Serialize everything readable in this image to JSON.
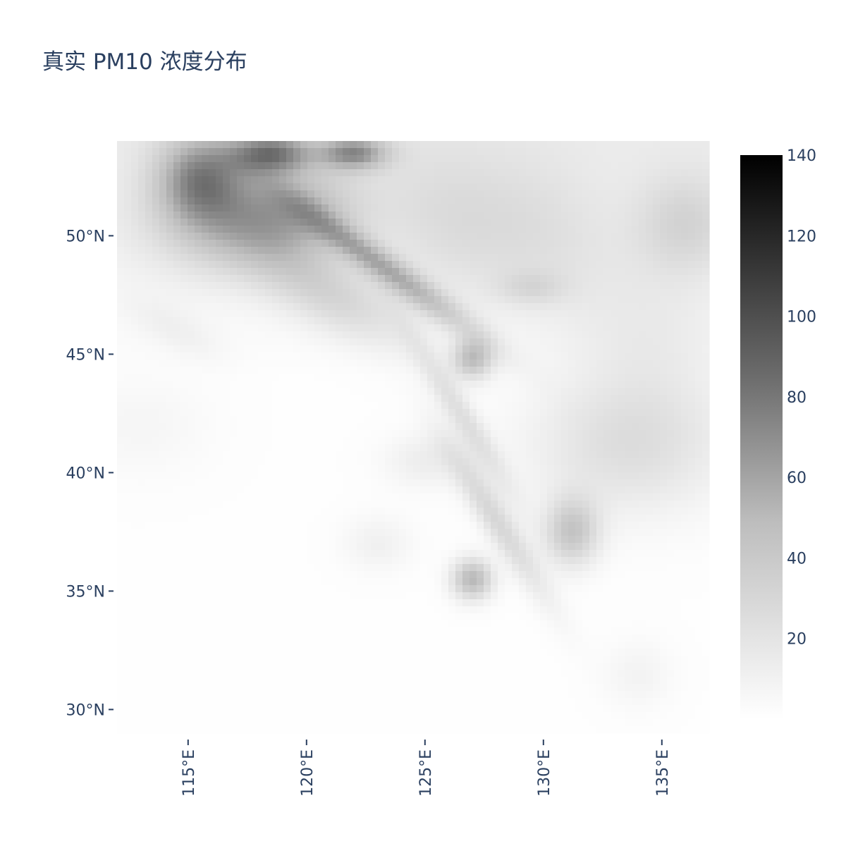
{
  "title": "真实 PM10 浓度分布",
  "chart_data": {
    "type": "heatmap",
    "title": "真实 PM10 浓度分布",
    "xlabel": "",
    "ylabel": "",
    "x_range": [
      112,
      137
    ],
    "y_range": [
      29,
      54
    ],
    "x_ticks": [
      115,
      120,
      125,
      130,
      135
    ],
    "x_tick_labels": [
      "115°E",
      "120°E",
      "125°E",
      "130°E",
      "135°E"
    ],
    "y_ticks": [
      50,
      45,
      40,
      35,
      30
    ],
    "y_tick_labels": [
      "50°N",
      "45°N",
      "40°N",
      "35°N",
      "30°N"
    ],
    "colorbar": {
      "range": [
        0,
        140
      ],
      "ticks": [
        140,
        120,
        100,
        80,
        60,
        40,
        20
      ],
      "tick_labels": [
        "140",
        "120",
        "100",
        "80",
        "60",
        "40",
        "20"
      ],
      "colorscale": [
        "#ffffff",
        "#000000"
      ]
    },
    "grid": false
  }
}
